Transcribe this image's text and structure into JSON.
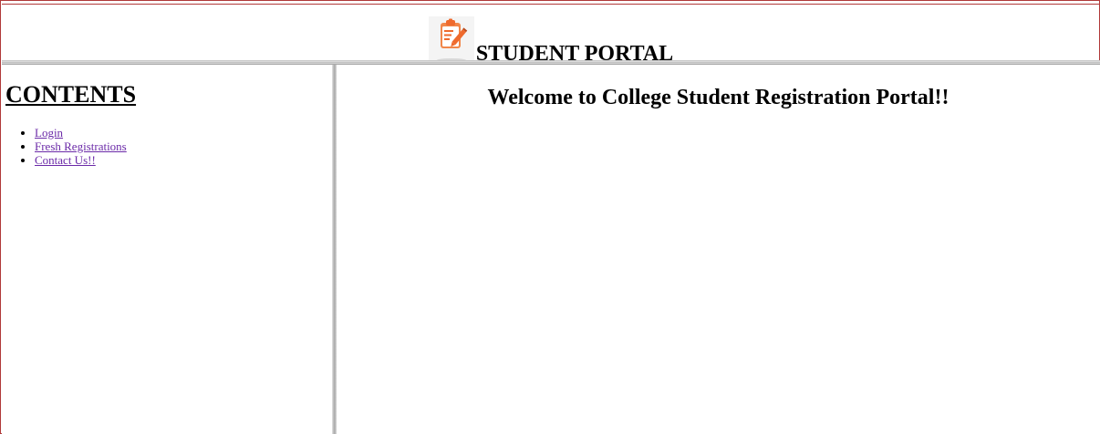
{
  "header": {
    "title": "STUDENT PORTAL",
    "logo_icon": "clipboard-pencil-icon",
    "logo_color": "#ef6a2d"
  },
  "sidebar": {
    "heading": "CONTENTS",
    "items": [
      {
        "label": "Login"
      },
      {
        "label": "Fresh Registrations"
      },
      {
        "label": "Contact Us!!"
      }
    ],
    "link_color": "#6b2aa8"
  },
  "main": {
    "welcome": "Welcome to College Student Registration Portal!!"
  },
  "colors": {
    "frame_border": "#b03a3a",
    "splitter": "#bdbdbd"
  }
}
